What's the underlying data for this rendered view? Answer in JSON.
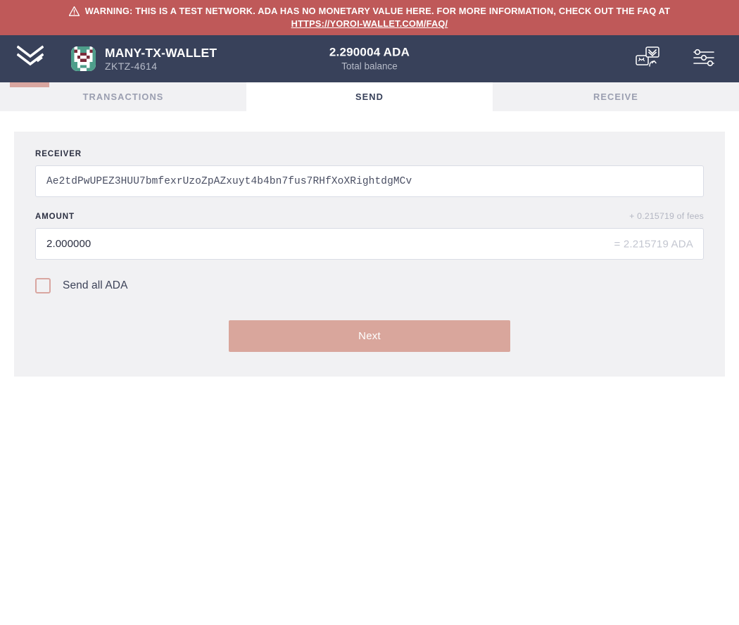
{
  "warning": {
    "icon": "warning-triangle-icon",
    "text": "WARNING: THIS IS A TEST NETWORK. ADA HAS NO MONETARY VALUE HERE. FOR MORE INFORMATION, CHECK OUT THE FAQ AT",
    "link_text": "HTTPS://YOROI-WALLET.COM/FAQ/",
    "background": "#bf5959",
    "text_color": "#ffffff"
  },
  "topbar": {
    "background": "#38415a",
    "logo": "yoroi-chevron-logo",
    "accent_color": "#d9a6a0",
    "wallet": {
      "avatar": "wallet-identicon",
      "name": "MANY-TX-WALLET",
      "id": "ZKTZ-4614"
    },
    "balance": {
      "amount": "2.290004 ADA",
      "label": "Total balance"
    },
    "actions": [
      {
        "name": "switch-wallet-icon",
        "label": "Switch wallet"
      },
      {
        "name": "settings-sliders-icon",
        "label": "Settings"
      }
    ]
  },
  "tabs": [
    {
      "label": "TRANSACTIONS",
      "active": false
    },
    {
      "label": "SEND",
      "active": true
    },
    {
      "label": "RECEIVE",
      "active": false
    }
  ],
  "send_form": {
    "receiver": {
      "label": "RECEIVER",
      "value": "Ae2tdPwUPEZ3HUU7bmfexrUzoZpAZxuyt4b4bn7fus7RHfXoXRightdgMCv",
      "placeholder": ""
    },
    "amount": {
      "label": "AMOUNT",
      "value": "2.000000",
      "placeholder": "",
      "fee_note": "+ 0.215719 of fees",
      "total_suffix": "= 2.215719 ADA"
    },
    "send_all": {
      "label": "Send all ADA",
      "checked": false
    },
    "submit": {
      "label": "Next",
      "color": "#d9a69c",
      "disabled": true
    }
  }
}
